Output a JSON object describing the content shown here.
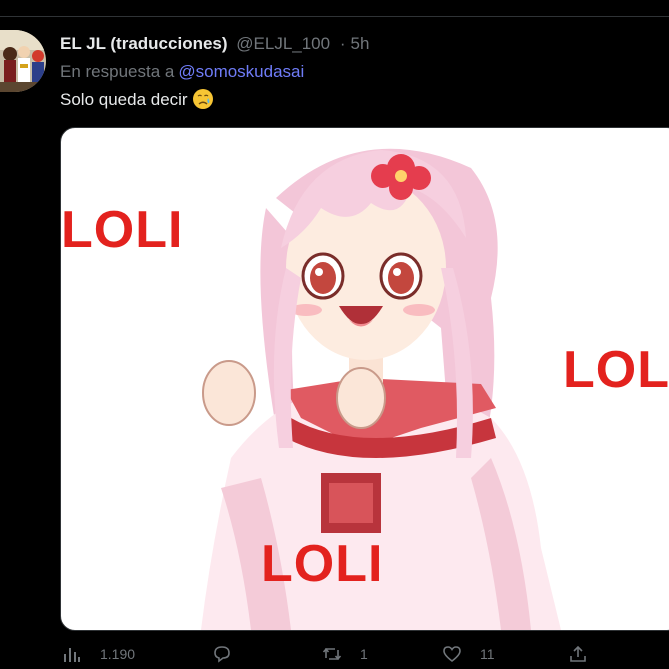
{
  "tweet": {
    "display_name": "EL JL (traducciones)",
    "handle": "@ELJL_100",
    "separator": "·",
    "time": "5h",
    "reply_prefix": "En respuesta a",
    "reply_to": "@somoskudasai",
    "text": "Solo queda decir",
    "emoji_icon": "crying-face-icon"
  },
  "media": {
    "captions": [
      "LOLI",
      "LOLI",
      "LOLI"
    ],
    "accent_red": "#e3221e"
  },
  "actions": {
    "views_count": "1.190",
    "replies_count": "",
    "retweets_count": "1",
    "likes_count": "11"
  },
  "colors": {
    "background": "#000000",
    "primary_text": "#e7e9ea",
    "secondary_text": "#71767b",
    "link": "#6f7cf7"
  }
}
